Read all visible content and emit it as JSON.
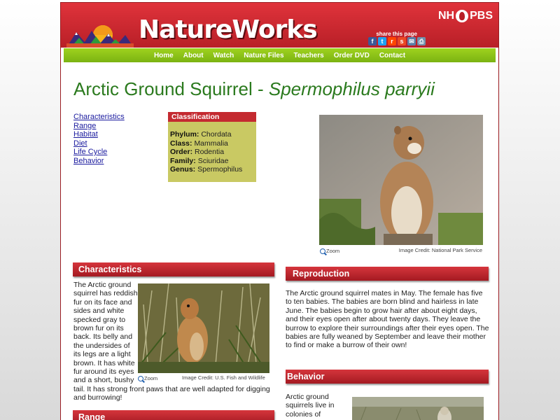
{
  "header": {
    "site_title": "NatureWorks",
    "station_prefix": "NH",
    "station_suffix": "PBS",
    "share_label": "share this page",
    "share_icons": [
      {
        "name": "facebook-icon",
        "glyph": "f",
        "color": "#3b5998"
      },
      {
        "name": "twitter-icon",
        "glyph": "t",
        "color": "#1da1f2"
      },
      {
        "name": "reddit-icon",
        "glyph": "r",
        "color": "#ff4500"
      },
      {
        "name": "stumbleupon-icon",
        "glyph": "s",
        "color": "#eb4924"
      },
      {
        "name": "email-icon",
        "glyph": "✉",
        "color": "#5a7fa8"
      },
      {
        "name": "print-icon",
        "glyph": "⎙",
        "color": "#6f8faa"
      }
    ]
  },
  "nav": {
    "items": [
      "Home",
      "About",
      "Watch",
      "Nature Files",
      "Teachers",
      "Order DVD",
      "Contact"
    ]
  },
  "page": {
    "title_common": "Arctic Ground Squirrel - ",
    "title_scientific": "Spermophilus parryii"
  },
  "toc": {
    "items": [
      "Characteristics",
      "Range",
      "Habitat",
      "Diet",
      "Life Cycle",
      "Behavior"
    ]
  },
  "classification": {
    "heading": "Classification",
    "rows": [
      {
        "label": "Phylum:",
        "value": "Chordata"
      },
      {
        "label": "Class:",
        "value": "Mammalia"
      },
      {
        "label": "Order:",
        "value": "Rodentia"
      },
      {
        "label": "Family:",
        "value": "Sciuridae"
      },
      {
        "label": "Genus:",
        "value": "Spermophilus"
      }
    ]
  },
  "photos": {
    "zoom_label": "Zoom",
    "main_credit": "Image Credit: National Park Service",
    "characteristics_credit": "Image Credit: U.S. Fish and Wildlife"
  },
  "sections": {
    "characteristics": {
      "heading": "Characteristics",
      "text": "The Arctic ground squirrel has reddish fur on its face and sides and white specked gray to brown fur on its back. Its belly and the undersides of its legs are a light brown. It has white fur around its eyes and a short, bushy tail. It has strong front paws that are well adapted for digging and burrowing!"
    },
    "reproduction": {
      "heading": "Reproduction",
      "text": "The Arctic ground squirrel mates in May. The female has five to ten babies. The babies are born blind and hairless in late June. The babies begin to grow hair after about eight days, and their eyes open after about twenty days. They leave the burrow to explore their surroundings after their eyes open. The babies are fully weaned by September and leave their mother to find or make a burrow of their own!"
    },
    "behavior": {
      "heading": "Behavior",
      "text": "Arctic ground squirrels live in colonies of"
    },
    "range": {
      "heading": "Range"
    }
  },
  "colors": {
    "brand_red": "#c42a30",
    "nav_green": "#8cc21a",
    "title_green": "#2b7a1e",
    "link_blue": "#1a1a9e"
  }
}
